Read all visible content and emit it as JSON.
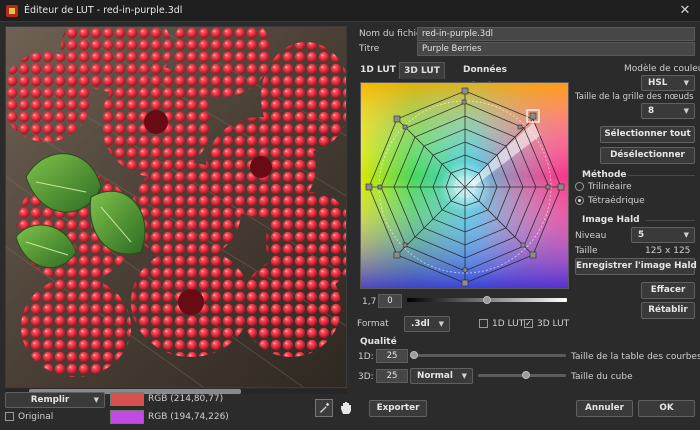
{
  "window": {
    "title": "Éditeur de LUT - red-in-purple.3dl"
  },
  "fields": {
    "filename_label": "Nom du fichier",
    "filename_value": "red-in-purple.3dl",
    "title_label": "Titre",
    "title_value": "Purple Berries"
  },
  "tabs": [
    "1D LUT",
    "3D LUT",
    "Données texte"
  ],
  "active_tab": "3D LUT",
  "right": {
    "color_model_label": "Modèle de couleur",
    "color_model_value": "HSL",
    "grid_size_label": "Taille de la grille des nœuds",
    "grid_size_value": "8",
    "select_all": "Sélectionner tout",
    "deselect": "Désélectionner",
    "method_title": "Méthode",
    "method_trilinear": "Trilinéaire",
    "method_tetrahedral": "Tétraédrique",
    "method_selected": "Tétraédrique",
    "hald_title": "Image Hald",
    "level_label": "Niveau",
    "level_value": "5",
    "size_label": "Taille",
    "size_value": "125 x 125",
    "save_hald": "Enregistrer l'image Hald",
    "clear": "Effacer",
    "reset": "Rétablir"
  },
  "gamma": {
    "label": "1,7",
    "value": "0",
    "slider_fraction": 0.5
  },
  "format": {
    "label": "Format",
    "value": ".3dl",
    "lut1d_label": "1D LUT",
    "lut1d_checked": false,
    "lut3d_label": "3D LUT",
    "lut3d_checked": true
  },
  "quality": {
    "title": "Qualité",
    "row1_label": "1D:",
    "row1_value": "25",
    "row1_slider_fraction": 0.0,
    "row1_caption": "Taille de la table des courbes",
    "row2_label": "3D:",
    "row2_value": "25",
    "row2_mode": "Normal",
    "row2_slider_fraction": 0.55,
    "row2_caption": "Taille du cube"
  },
  "bottom": {
    "fill_label": "Remplir",
    "original_label": "Original",
    "color1_text": "RGB (214,80,77)",
    "color1_hex": "#d6504d",
    "color2_text": "RGB (194,74,226)",
    "color2_hex": "#c24ae2",
    "export_label": "Exporter",
    "cancel_label": "Annuler",
    "ok_label": "OK"
  },
  "icons": {
    "app": "app-logo-icon",
    "close": "close-icon",
    "eyedropper": "eyedropper-icon",
    "hand": "hand-pan-icon",
    "dropdown": "chevron-down-icon"
  }
}
